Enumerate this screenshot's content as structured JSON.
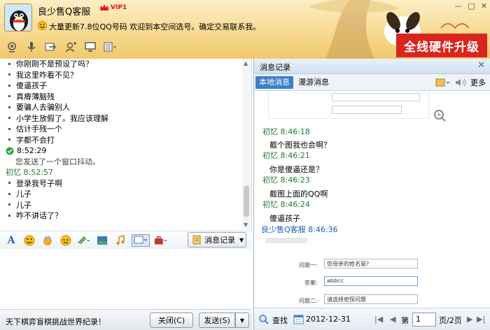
{
  "header": {
    "name": "良少售Q客服",
    "vip_label": "VIP1",
    "status_text": "大量更新7.8位QQ号码  欢迎到本空间选号。确定交易联系我。",
    "upgrade_banner": "全线硬件升级"
  },
  "chat": {
    "lines": [
      {
        "kind": "msg",
        "text": "你刚刚不是预设了吗？"
      },
      {
        "kind": "msg",
        "text": "我这里咋看不见？"
      },
      {
        "kind": "msg",
        "text": "傻逼孩子"
      },
      {
        "kind": "msg",
        "text": "真瘠薄脑残"
      },
      {
        "kind": "msg",
        "text": "要骗人去骗别人"
      },
      {
        "kind": "msg",
        "text": "小学生放假了。我应该理解"
      },
      {
        "kind": "msg",
        "text": "估计手残一个"
      },
      {
        "kind": "msg",
        "text": "字都不会打"
      },
      {
        "kind": "time",
        "text": "8:52:29"
      },
      {
        "kind": "sys",
        "text": "您发送了一个窗口抖动。"
      },
      {
        "kind": "sender",
        "text": "初忆  8:52:57"
      },
      {
        "kind": "msg",
        "text": "登录我号子啊"
      },
      {
        "kind": "msg",
        "text": "儿子"
      },
      {
        "kind": "msg",
        "text": "儿子"
      },
      {
        "kind": "msg",
        "text": "咋不讲话了？"
      }
    ],
    "history_button": "消息记录",
    "ad_text": "天下棋弈盲棋挑战世界纪录！",
    "close_button": "关闭(C)",
    "send_button": "发送(S)"
  },
  "history": {
    "title": "消息记录",
    "tabs": [
      "本地消息",
      "漫游消息"
    ],
    "more_label": "更多",
    "entries": [
      {
        "sender": "初忆  8:46:18",
        "text": "截个图我也会啊？"
      },
      {
        "sender": "初忆  8:46:21",
        "text": "你是傻逼还是？"
      },
      {
        "sender": "初忆  8:46:23",
        "text": "截图上面的QQ啊"
      },
      {
        "sender": "初忆  8:46:24",
        "text": "傻逼孩子"
      },
      {
        "sender": "良少售Q客服  8:46:36",
        "text": ""
      }
    ],
    "form_q1_label": "问题一:",
    "form_q1_value": "您母亲的姓名是?",
    "form_answer_label": "答案:",
    "form_answer_value": "abbcc",
    "form_q2_label": "问题二:",
    "form_q2_value": "请选择密保问题",
    "search_label": "查找",
    "date": "2012-12-31",
    "page_prefix": "第",
    "page_value": "1",
    "page_suffix": "页/2页"
  },
  "colors": {
    "accent": "#3d7fc7",
    "banner": "#d9251d",
    "sender_green": "#1f7a3a",
    "sender_blue": "#1d5fb3"
  }
}
